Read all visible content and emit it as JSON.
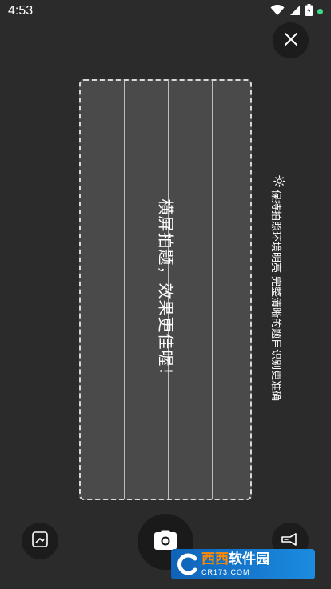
{
  "status_bar": {
    "time": "4:53"
  },
  "camera": {
    "main_hint": "横屏拍题，效果更佳喔！",
    "side_tip": "保持拍照环境明亮 完整清晰的题目识别更准确"
  },
  "watermark": {
    "brand_a": "西西",
    "brand_b": "软件园",
    "url": "CR173.COM"
  },
  "colors": {
    "background": "#2b2b2b",
    "frame_fill": "#4a4a4a",
    "battery_dot": "#3ddc84"
  }
}
